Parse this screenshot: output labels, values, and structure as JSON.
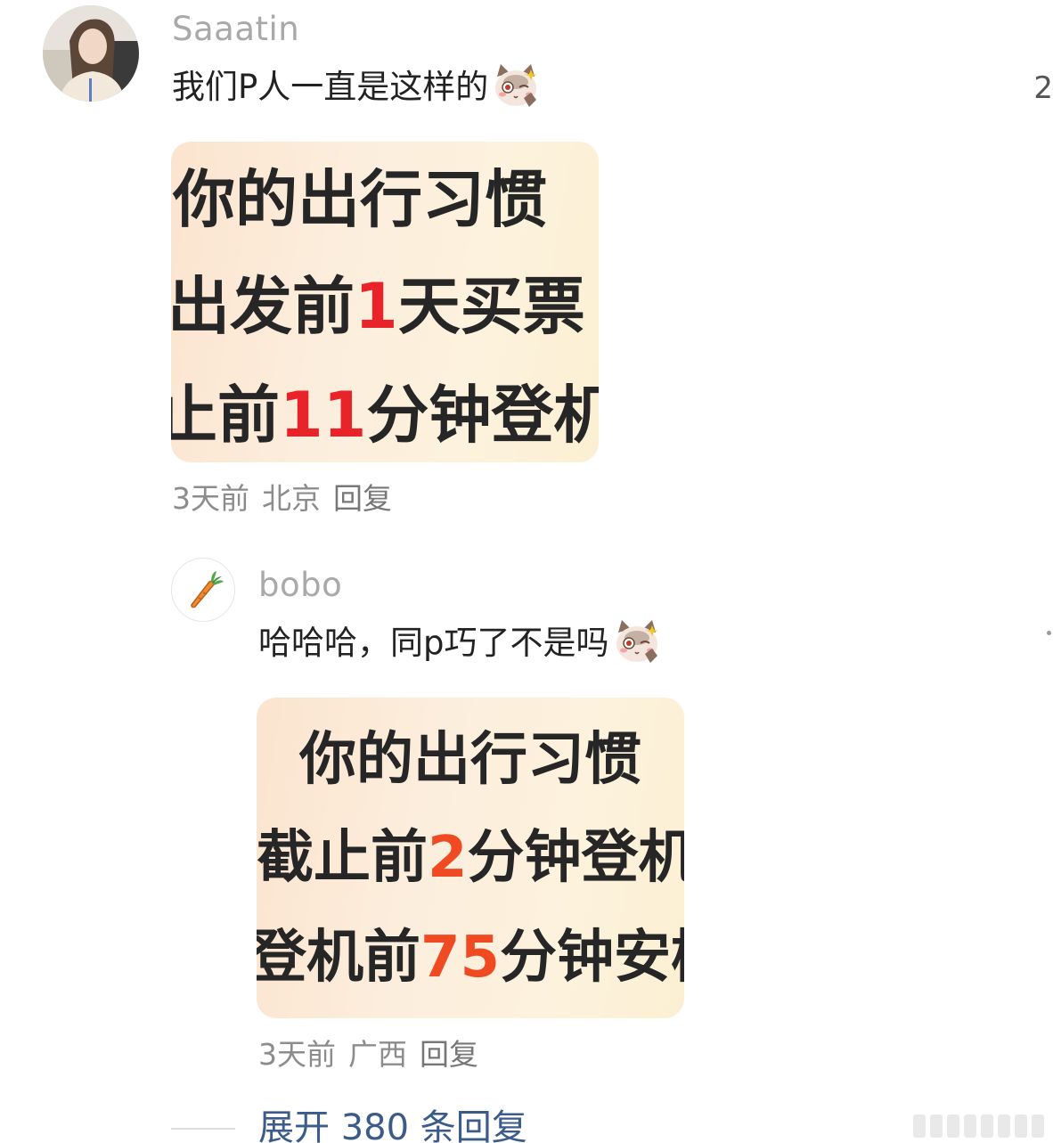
{
  "comment": {
    "username": "Saaatin",
    "text": "我们P人一直是这样的",
    "emoji": "cat-wink-emoji",
    "image_lines": [
      {
        "before": "你的出行习惯",
        "highlight": "",
        "after": ""
      },
      {
        "before": "出发前",
        "highlight": "1",
        "after": "天买票"
      },
      {
        "before": "止前",
        "highlight": "11",
        "after": "分钟登机"
      }
    ],
    "meta": {
      "time": "3天前",
      "location": "北京",
      "reply": "回复"
    },
    "like_count_partial": "2"
  },
  "reply": {
    "username": "bobo",
    "avatar_icon": "carrot-icon",
    "text": "哈哈哈，同p巧了不是吗",
    "emoji": "cat-wink-emoji",
    "image_lines": [
      {
        "before": "你的出行习惯",
        "highlight": "",
        "after": ""
      },
      {
        "before": "截止前",
        "highlight": "2",
        "after": "分钟登机"
      },
      {
        "before": "登机前",
        "highlight": "75",
        "after": "分钟安检"
      }
    ],
    "meta": {
      "time": "3天前",
      "location": "广西",
      "reply": "回复"
    }
  },
  "expand": {
    "label": "展开 380 条回复"
  },
  "colors": {
    "username": "#a9a9a9",
    "text": "#222222",
    "meta": "#8c8c8c",
    "link": "#3b5c8a",
    "highlight_red": "#e8232a",
    "highlight_orange": "#ef4a22"
  }
}
